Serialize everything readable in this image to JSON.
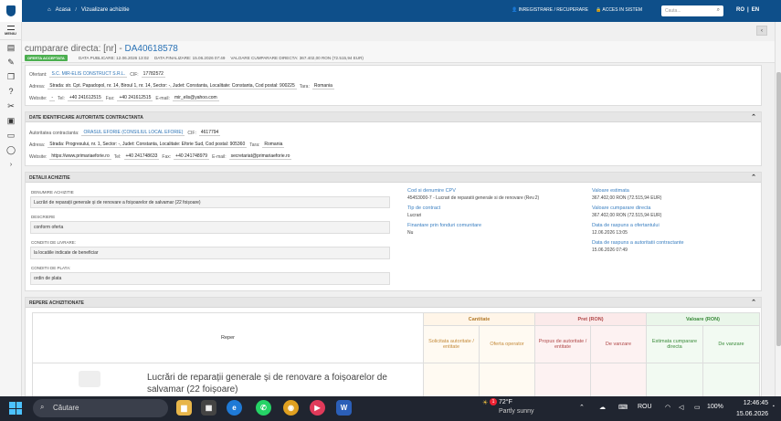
{
  "topbar": {
    "home": "Acasa",
    "sep": "/",
    "page": "Vizualizare achizitie",
    "link1": "INREGISTRARE / RECUPERARE",
    "link2": "ACCES IN SISTEM",
    "search_placeholder": "Cauta...",
    "lang_ro": "RO",
    "lang_sep": "|",
    "lang_en": "EN"
  },
  "sidebar": {
    "menu": "MENIU",
    "icons": [
      "document-icon",
      "document-edit-icon",
      "layers-icon",
      "help-icon",
      "tools-icon",
      "gallery-icon",
      "monitor-icon",
      "chat-icon",
      "chevron-right-icon"
    ]
  },
  "header": {
    "title_prefix": "cumparare directa: [nr] - ",
    "code": "DA40618578",
    "badge": "OFERTA ACCEPTATA",
    "pub": "DATA PUBLICARE: 12.06.2026 13:02",
    "fin": "DATA FINALIZARE: 15.06.2026 07:49",
    "val": "VALOARE CUMPARARE DIRECTA: 367.402,00 RON (72.515,94 EUR)"
  },
  "ofertant": {
    "l_ofertant": "Ofertant:",
    "ofertant": "S.C. MIR-ELIS CONSTRUCT S.R.L.",
    "l_cif": "CIF:",
    "cif": "17782572",
    "l_adresa": "Adresa:",
    "adresa": "Strada: str. Cpt. Papadopol, nr. 14, Biroul 1, nr. 14, Sector: -, Judet: Constanta, Localitate: Constanta, Cod postal: 900225",
    "l_tara": "Tara:",
    "tara": "Romania",
    "l_web": "Website:",
    "web": "-",
    "l_tel": "Tel:",
    "tel": "+40 241612515",
    "l_fax": "Fax:",
    "fax": "+40 241612515",
    "l_email": "E-mail:",
    "email": "mir_elis@yahoo.com"
  },
  "autoritate": {
    "heading": "DATE IDENTIFICARE AUTORITATE CONTRACTANTA",
    "l_aut": "Autoritatea contractanta:",
    "aut": "ORASUL EFORIE (CONSILIUL LOCAL EFORIE)",
    "l_cif": "CIF:",
    "cif": "4617794",
    "l_adresa": "Adresa:",
    "adresa": "Strada: Progresului, nr. 1, Sector: -, Judet: Constanta, Localitate: Eforie Sud, Cod postal: 905360",
    "l_tara": "Tara:",
    "tara": "Romania",
    "l_web": "Website:",
    "web": "https://www.primariaeforie.ro",
    "l_tel": "Tel:",
    "tel": "+40 241748633",
    "l_fax": "Fax:",
    "fax": "+40 241748979",
    "l_email": "E-mail:",
    "email": "secretariat@primariaeforie.ro"
  },
  "detalii": {
    "heading": "DETALII ACHIZITIE",
    "l_denumire": "DENUMIRE ACHIZITIE",
    "denumire": "Lucrări de reparații generale și de renovare a foișoarelor de salvamar (22 foișoare)",
    "l_descriere": "DESCRIERE",
    "descriere": "conform oferta",
    "l_livrare": "CONDITII DE LIVRARE:",
    "livrare": "la locatiile indicate de beneficiar",
    "l_plata": "CONDITII DE PLATA:",
    "plata": "ordin de plata",
    "l_cpv": "Cod si denumire CPV",
    "cpv": "45453000-7 - Lucrari de reparatii generale si de renovare (Rev.2)",
    "l_tip": "Tip de contract",
    "tip": "Lucrari",
    "l_fin": "Finantare prin fonduri comunitare",
    "fin": "Nu",
    "l_est": "Valoare estimata",
    "est": "367.402,00  RON (72.515,94  EUR)",
    "l_vcd": "Valoare cumparare directa",
    "vcd": "367.402,00  RON (72.515,94  EUR)",
    "l_dro": "Data de raspuns a ofertantului",
    "dro": "12.06.2026 13:05",
    "l_dra": "Data de raspuns a autoritatii contractante",
    "dra": "15.06.2026 07:49"
  },
  "repere": {
    "heading": "REPERE ACHIZITIONATE",
    "col_reper": "Reper",
    "g_cant": "Cantitate",
    "g_pret": "Pret (RON)",
    "g_val": "Valoare (RON)",
    "c1": "Solicitata autoritate / entitate",
    "c2": "Oferta operator",
    "c3": "Propus de autoritate / entitate",
    "c4": "De vanzare",
    "c5": "Estimata cumparare directa",
    "c6": "De vanzare",
    "item": "Lucrări de reparații generale și de renovare a foișoarelor de salvamar (22 foișoare)"
  },
  "taskbar": {
    "search": "Căutare",
    "temp": "72°F",
    "cond": "Partly sunny",
    "badge": "1",
    "lang": "ROU",
    "battery": "100%",
    "time": "12:46:45",
    "date": "15.06.2026"
  }
}
